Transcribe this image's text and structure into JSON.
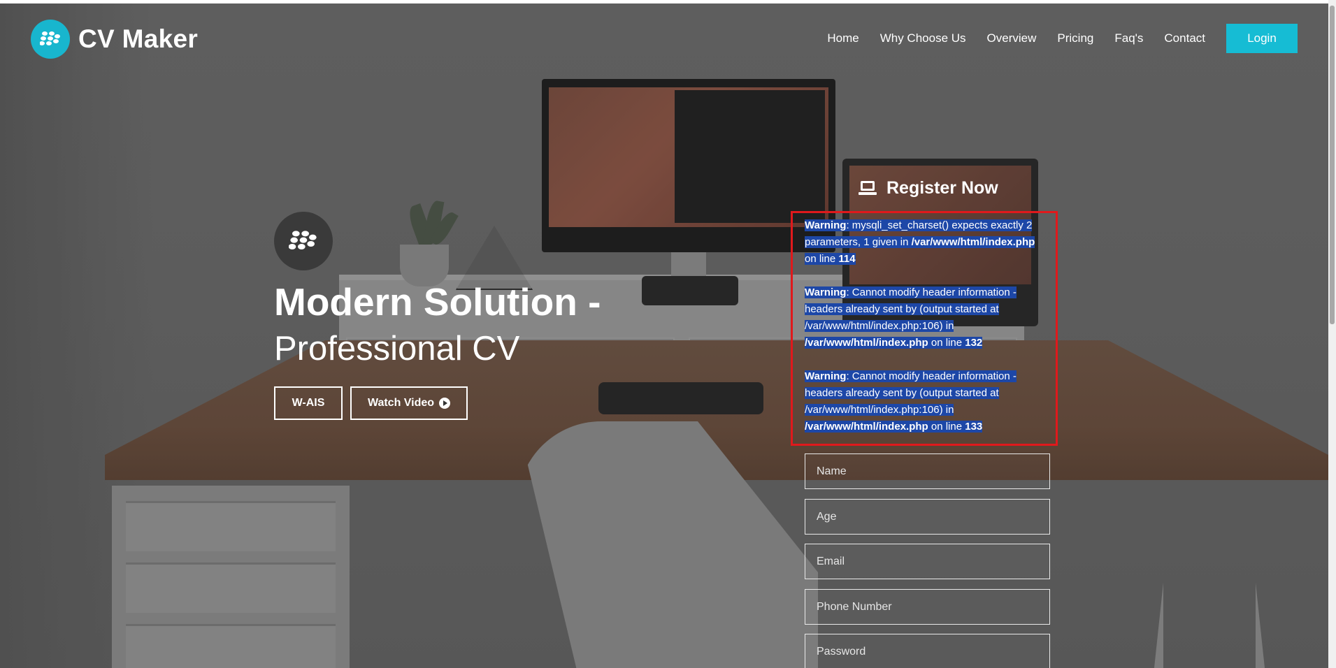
{
  "brand": {
    "name": "CV Maker",
    "logo_icon": "blackberry-logo-icon",
    "color": "#18b6ce"
  },
  "nav": {
    "links": [
      "Home",
      "Why Choose Us",
      "Overview",
      "Pricing",
      "Faq's",
      "Contact"
    ],
    "login_label": "Login",
    "login_color": "#16bcd4"
  },
  "hero": {
    "title": "Modern Solution -",
    "subtitle": "Professional CV",
    "buttons": {
      "primary_label": "W-AIS",
      "video_label": "Watch Video",
      "video_icon": "play-circle-icon"
    }
  },
  "register": {
    "title": "Register Now",
    "icon": "laptop-icon",
    "warnings": [
      {
        "label": "Warning",
        "message": ": mysqli_set_charset() expects exactly 2 parameters, 1 given in ",
        "file": "/var/www/html/index.php",
        "line_prefix": " on line ",
        "line": "114"
      },
      {
        "label": "Warning",
        "message": ": Cannot modify header information - headers already sent by (output started at /var/www/html/index.php:106) in ",
        "file": "/var/www/html/index.php",
        "line_prefix": " on line ",
        "line": "132"
      },
      {
        "label": "Warning",
        "message": ": Cannot modify header information - headers already sent by (output started at /var/www/html/index.php:106) in ",
        "file": "/var/www/html/index.php",
        "line_prefix": " on line ",
        "line": "133"
      }
    ],
    "warning_border_color": "#e0191c",
    "selection_color": "#1d47a7",
    "fields": {
      "name_placeholder": "Name",
      "age_placeholder": "Age",
      "email_placeholder": "Email",
      "phone_placeholder": "Phone Number",
      "password_placeholder": "Password"
    }
  }
}
